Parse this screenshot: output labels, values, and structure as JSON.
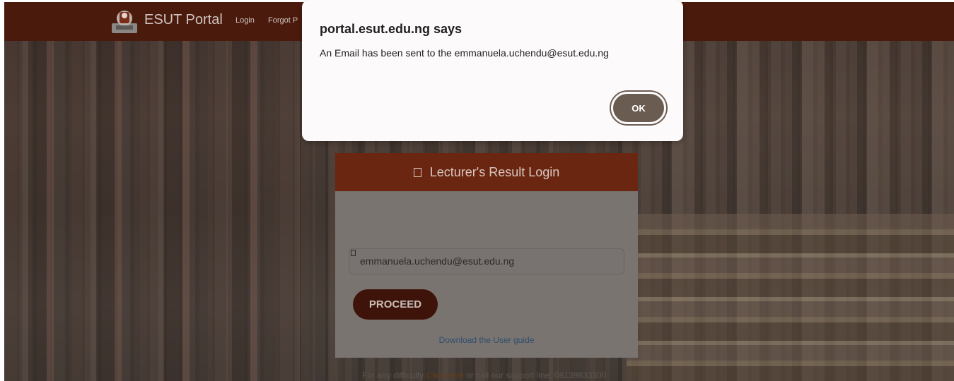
{
  "navbar": {
    "brand": "ESUT Portal",
    "links": [
      "Login",
      "Forgot P"
    ]
  },
  "login_card": {
    "title": "Lecturer's Result Login",
    "email_value": "emmanuela.uchendu@esut.edu.ng",
    "proceed_label": "PROCEED",
    "guide_link": "Download the User guide"
  },
  "support": {
    "prefix": "For any difficulty",
    "link": "Click here",
    "suffix": "or call our support line: 08139833300"
  },
  "dialog": {
    "title": "portal.esut.edu.ng says",
    "message": "An Email has been sent to the emmanuela.uchendu@esut.edu.ng",
    "ok_label": "OK"
  },
  "colors": {
    "navbar": "#4a1a0d",
    "card_header": "#6a2611",
    "proceed_button": "#3e1309",
    "ok_button": "#6b5c52"
  }
}
